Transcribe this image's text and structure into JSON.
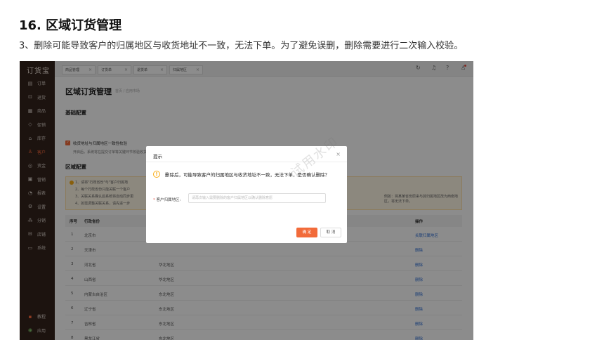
{
  "doc": {
    "title": "16. 区域订货管理",
    "description": "3、删除可能导致客户的归属地区与收货地址不一致，无法下单。为了避免误删，删除需要进行二次输入校验。"
  },
  "app": {
    "logo": "订货宝",
    "sidebar": [
      {
        "label": "订单",
        "icon": "order-icon",
        "glyph": "▤"
      },
      {
        "label": "退货",
        "icon": "return-icon",
        "glyph": "⊡"
      },
      {
        "label": "商品",
        "icon": "goods-icon",
        "glyph": "▦"
      },
      {
        "label": "促销",
        "icon": "promo-icon",
        "glyph": "◇"
      },
      {
        "label": "库存",
        "icon": "stock-icon",
        "glyph": "⌂"
      },
      {
        "label": "客户",
        "icon": "customer-icon",
        "glyph": "♙"
      },
      {
        "label": "资金",
        "icon": "funds-icon",
        "glyph": "◎"
      },
      {
        "label": "营销",
        "icon": "marketing-icon",
        "glyph": "▣"
      },
      {
        "label": "报表",
        "icon": "report-icon",
        "glyph": "◔"
      },
      {
        "label": "设置",
        "icon": "settings-icon",
        "glyph": "⚙"
      },
      {
        "label": "分销",
        "icon": "distribution-icon",
        "glyph": "⁂"
      },
      {
        "label": "店铺",
        "icon": "shop-icon",
        "glyph": "⊟"
      },
      {
        "label": "系统",
        "icon": "system-icon",
        "glyph": "▭"
      }
    ],
    "sidebar_bottom": [
      {
        "label": "教程",
        "icon": "tutorial-icon",
        "glyph": "▪"
      },
      {
        "label": "应用",
        "icon": "apps-icon",
        "glyph": "◉"
      }
    ],
    "active_nav": "客户",
    "tabs": [
      "商品管理",
      "订货单",
      "退货单",
      "归属地区"
    ],
    "page_title": "区域订货管理",
    "breadcrumb": "首页 / 应用市场",
    "basic_section": "基础配置",
    "checkbox_label": "收货地址与归属地区一致性校验",
    "help_text": "开启后，系统将在提交订单等关键环节校验收货地址与客户归属地区是否一致，不一致时将提示错误并阻止操作。",
    "region_section": "区域配置",
    "alert_lines": [
      "1、请将\"行政省份\"与\"客户归属地",
      "2、每个行政省份只能关联一个客户",
      "3、关联关系确认后系统将自动同步更",
      "4、如需调整关联关系，请先进一步"
    ],
    "alert_right": "例如：将某某省份原来与其归属地区改为西南地区，将无法下单。",
    "table": {
      "headers": [
        "序号",
        "行政省份",
        "操作"
      ],
      "rows": [
        {
          "no": "1",
          "province": "北京市",
          "region": "",
          "action": "关联归属地区"
        },
        {
          "no": "2",
          "province": "天津市",
          "region": "",
          "action": "删除"
        },
        {
          "no": "3",
          "province": "河北省",
          "region": "华北地区",
          "action": "删除"
        },
        {
          "no": "4",
          "province": "山西省",
          "region": "华北地区",
          "action": "删除"
        },
        {
          "no": "5",
          "province": "内蒙古自治区",
          "region": "东北地区",
          "action": "删除"
        },
        {
          "no": "6",
          "province": "辽宁省",
          "region": "东北地区",
          "action": "删除"
        },
        {
          "no": "7",
          "province": "吉林省",
          "region": "东北地区",
          "action": "删除"
        },
        {
          "no": "8",
          "province": "黑龙江省",
          "region": "东北地区",
          "action": "删除"
        }
      ]
    },
    "modal": {
      "title": "提示",
      "warning": "删除后，可能导致客户的归属地区与收货地址不一致，无法下单，是否确认删除？",
      "field_label": "客户归属地区:",
      "field_placeholder": "请再次输入需要删除的客户归属地区以确认删除意愿",
      "ok": "确 定",
      "cancel": "取 消"
    },
    "watermark": "试用水印"
  }
}
